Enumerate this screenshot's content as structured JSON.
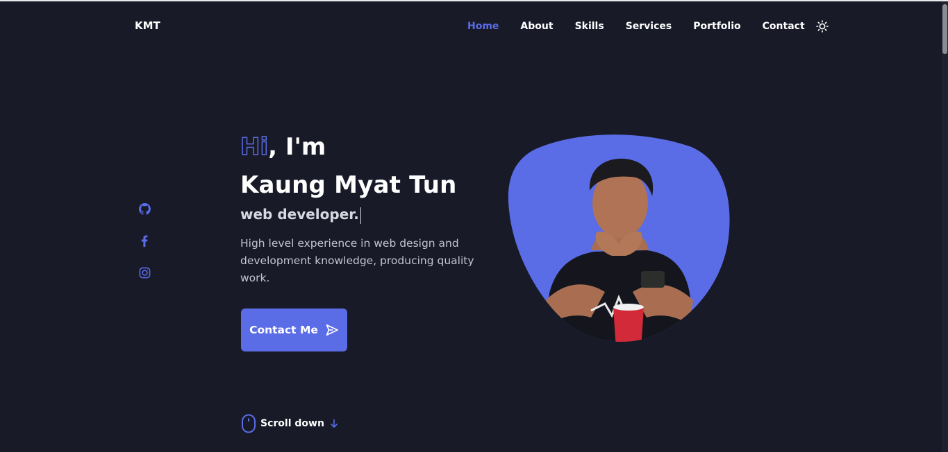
{
  "header": {
    "logo": "KMT",
    "nav": [
      {
        "label": "Home",
        "active": true
      },
      {
        "label": "About",
        "active": false
      },
      {
        "label": "Skills",
        "active": false
      },
      {
        "label": "Services",
        "active": false
      },
      {
        "label": "Portfolio",
        "active": false
      },
      {
        "label": "Contact",
        "active": false
      }
    ],
    "theme_toggle_icon": "sun-icon"
  },
  "social": [
    {
      "icon": "github-icon"
    },
    {
      "icon": "facebook-icon"
    },
    {
      "icon": "instagram-icon"
    }
  ],
  "hero": {
    "greeting_accent": "Hi",
    "greeting_rest": ", I'm",
    "name": "Kaung Myat Tun",
    "role": "web developer.",
    "description": "High level experience in web design and development knowledge, producing quality work.",
    "cta_label": "Contact Me",
    "cta_icon": "send-icon",
    "photo_icon": "profile-photo"
  },
  "scroll": {
    "label": "Scroll down",
    "mouse_icon": "mouse-icon",
    "arrow_icon": "arrow-down-icon"
  },
  "colors": {
    "background": "#181a28",
    "accent": "#5a6ce6",
    "text": "#ffffff",
    "muted_text": "#c3c5d0"
  }
}
